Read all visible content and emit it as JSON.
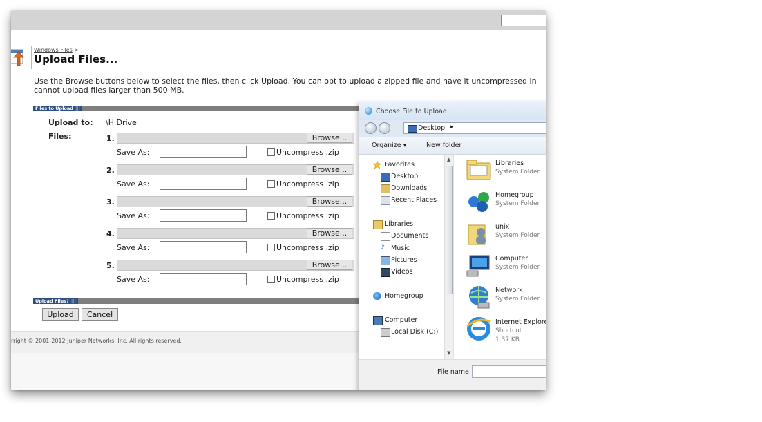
{
  "page": {
    "breadcrumb_link": "Windows Files",
    "breadcrumb_sep": ">",
    "title": "Upload Files...",
    "instructions": "Use the Browse buttons below to select the files, then click Upload. You can opt to upload a zipped file and have it uncompressed in cannot upload files larger than 500 MB."
  },
  "files_section": {
    "header": "Files to Upload",
    "upload_to_label": "Upload to:",
    "upload_to_value": "\\H Drive",
    "files_label": "Files:",
    "browse_label": "Browse...",
    "save_as_label": "Save As:",
    "uncompress_label": "Uncompress .zip",
    "rows": [
      {
        "num": "1."
      },
      {
        "num": "2."
      },
      {
        "num": "3."
      },
      {
        "num": "4."
      },
      {
        "num": "5."
      }
    ]
  },
  "upload_section": {
    "header": "Upload Files?",
    "upload_button": "Upload",
    "cancel_button": "Cancel"
  },
  "footer": {
    "copyright": "rright © 2001-2012 Juniper Networks, Inc. All rights reserved."
  },
  "dialog": {
    "title": "Choose File to Upload",
    "path": "Desktop",
    "toolbar": {
      "organize": "Organize ▾",
      "new_folder": "New folder"
    },
    "nav": {
      "favorites": "Favorites",
      "desktop": "Desktop",
      "downloads": "Downloads",
      "recent_places": "Recent Places",
      "libraries": "Libraries",
      "documents": "Documents",
      "music": "Music",
      "pictures": "Pictures",
      "videos": "Videos",
      "homegroup": "Homegroup",
      "computer": "Computer",
      "local_disk": "Local Disk (C:)"
    },
    "items": [
      {
        "name": "Libraries",
        "type": "System Folder",
        "icon": "libraries-icon"
      },
      {
        "name": "Homegroup",
        "type": "System Folder",
        "icon": "homegroup-icon"
      },
      {
        "name": "unix",
        "type": "System Folder",
        "icon": "user-folder-icon"
      },
      {
        "name": "Computer",
        "type": "System Folder",
        "icon": "computer-icon"
      },
      {
        "name": "Network",
        "type": "System Folder",
        "icon": "network-icon"
      },
      {
        "name": "Internet Explorer",
        "type": "Shortcut",
        "size": "1.37 KB",
        "icon": "internet-explorer-icon"
      }
    ],
    "file_name_label": "File name:"
  }
}
